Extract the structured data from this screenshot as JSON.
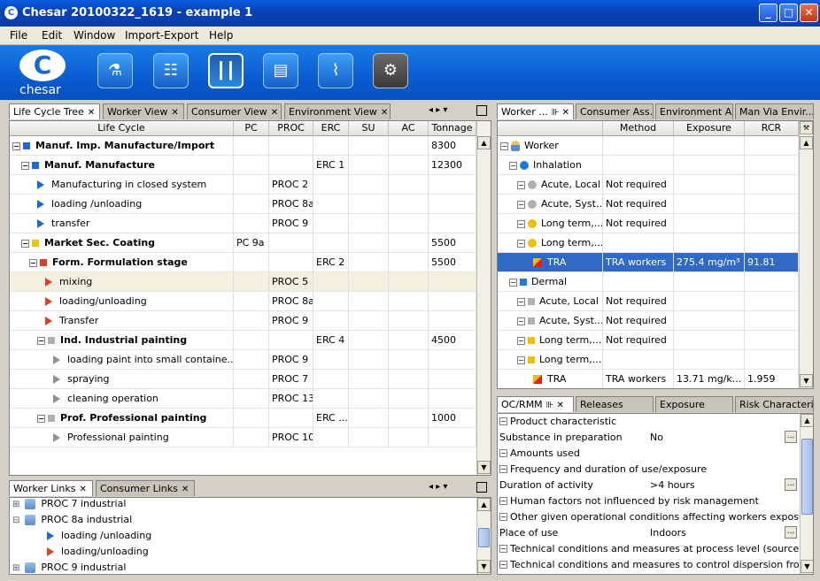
{
  "window": {
    "title": "Chesar 20100322_1619 - example 1"
  },
  "menu": [
    "File",
    "Edit",
    "Window",
    "Import-Export",
    "Help"
  ],
  "toolbar": {
    "logo_text": "chesar"
  },
  "lc_tabs": [
    "Life Cycle Tree",
    "Worker View",
    "Consumer View",
    "Environment View"
  ],
  "lc_columns": [
    "Life Cycle",
    "PC",
    "PROC",
    "ERC",
    "SU",
    "AC",
    "Tonnage"
  ],
  "lc_rows": [
    {
      "name": "Manuf. Imp. Manufacture/Import",
      "pc": "",
      "proc": "",
      "erc": "",
      "ton": "8300"
    },
    {
      "name": "Manuf. Manufacture",
      "pc": "",
      "proc": "",
      "erc": "ERC 1",
      "ton": "12300"
    },
    {
      "name": "Manufacturing in closed system",
      "pc": "",
      "proc": "PROC 2",
      "erc": "",
      "ton": ""
    },
    {
      "name": "loading /unloading",
      "pc": "",
      "proc": "PROC 8a",
      "erc": "",
      "ton": ""
    },
    {
      "name": "transfer",
      "pc": "",
      "proc": "PROC 9",
      "erc": "",
      "ton": ""
    },
    {
      "name": "Market Sec. Coating",
      "pc": "PC 9a",
      "proc": "",
      "erc": "",
      "ton": "5500"
    },
    {
      "name": "Form. Formulation stage",
      "pc": "",
      "proc": "",
      "erc": "ERC 2",
      "ton": "5500"
    },
    {
      "name": "mixing",
      "pc": "",
      "proc": "PROC 5",
      "erc": "",
      "ton": ""
    },
    {
      "name": "loading/unloading",
      "pc": "",
      "proc": "PROC 8a",
      "erc": "",
      "ton": ""
    },
    {
      "name": "Transfer",
      "pc": "",
      "proc": "PROC 9",
      "erc": "",
      "ton": ""
    },
    {
      "name": "Ind. Industrial painting",
      "pc": "",
      "proc": "",
      "erc": "ERC 4",
      "ton": "4500"
    },
    {
      "name": "loading paint into small containe...",
      "pc": "",
      "proc": "PROC 9",
      "erc": "",
      "ton": ""
    },
    {
      "name": "spraying",
      "pc": "",
      "proc": "PROC 7",
      "erc": "",
      "ton": ""
    },
    {
      "name": "cleaning operation",
      "pc": "",
      "proc": "PROC 13",
      "erc": "",
      "ton": ""
    },
    {
      "name": "Prof. Professional painting",
      "pc": "",
      "proc": "",
      "erc": "ERC ...",
      "ton": "1000"
    },
    {
      "name": "Professional painting",
      "pc": "",
      "proc": "PROC 10",
      "erc": "",
      "ton": ""
    }
  ],
  "links_tabs": [
    "Worker Links",
    "Consumer Links"
  ],
  "links_rows": [
    "PROC 7 industrial",
    "PROC 8a industrial",
    "loading /unloading",
    "loading/unloading",
    "PROC 9 industrial"
  ],
  "worker_tabs": [
    "Worker ...",
    "Consumer Ass...",
    "Environment A...",
    "Man Via Envir..."
  ],
  "worker_columns": [
    "",
    "Method",
    "Exposure",
    "RCR"
  ],
  "worker_rows": [
    {
      "name": "Worker",
      "method": "",
      "exp": "",
      "rcr": ""
    },
    {
      "name": "Inhalation",
      "method": "",
      "exp": "",
      "rcr": ""
    },
    {
      "name": "Acute, Local",
      "method": "Not required",
      "exp": "",
      "rcr": ""
    },
    {
      "name": "Acute, Syst...",
      "method": "Not required",
      "exp": "",
      "rcr": ""
    },
    {
      "name": "Long term,...",
      "method": "Not required",
      "exp": "",
      "rcr": ""
    },
    {
      "name": "Long term,...",
      "method": "",
      "exp": "",
      "rcr": ""
    },
    {
      "name": "TRA",
      "method": "TRA workers",
      "exp": "275.4 mg/m³",
      "rcr": "91.81"
    },
    {
      "name": "Dermal",
      "method": "",
      "exp": "",
      "rcr": ""
    },
    {
      "name": "Acute, Local",
      "method": "Not required",
      "exp": "",
      "rcr": ""
    },
    {
      "name": "Acute, Syst...",
      "method": "Not required",
      "exp": "",
      "rcr": ""
    },
    {
      "name": "Long term,...",
      "method": "Not required",
      "exp": "",
      "rcr": ""
    },
    {
      "name": "Long term,...",
      "method": "",
      "exp": "",
      "rcr": ""
    },
    {
      "name": "TRA",
      "method": "TRA workers",
      "exp": "13.71 mg/k...",
      "rcr": "1.959"
    }
  ],
  "oc_tabs": [
    "OC/RMM",
    "Releases",
    "Exposure",
    "Risk Characteri..."
  ],
  "oc_props": [
    {
      "label": "Product characteristic",
      "value": "",
      "section": true
    },
    {
      "label": "Substance in preparation",
      "value": "No",
      "section": false
    },
    {
      "label": "Amounts used",
      "value": "",
      "section": true
    },
    {
      "label": "Frequency and duration of use/exposure",
      "value": "",
      "section": true
    },
    {
      "label": "Duration of activity",
      "value": ">4 hours",
      "section": false
    },
    {
      "label": "Human factors not influenced by risk management",
      "value": "",
      "section": true
    },
    {
      "label": "Other given operational conditions affecting  workers exposure",
      "value": "",
      "section": true
    },
    {
      "label": "Place of use",
      "value": "Indoors",
      "section": false
    },
    {
      "label": "Technical conditions and measures at process level (source) to prevent release",
      "value": "",
      "section": true
    },
    {
      "label": "Technical conditions and measures to control dispersion from source towards the worker",
      "value": "",
      "section": true
    }
  ],
  "colors": {
    "title": "#0a4bc8",
    "toolbar": "#0a5cd0",
    "selected": "#3169c6"
  }
}
